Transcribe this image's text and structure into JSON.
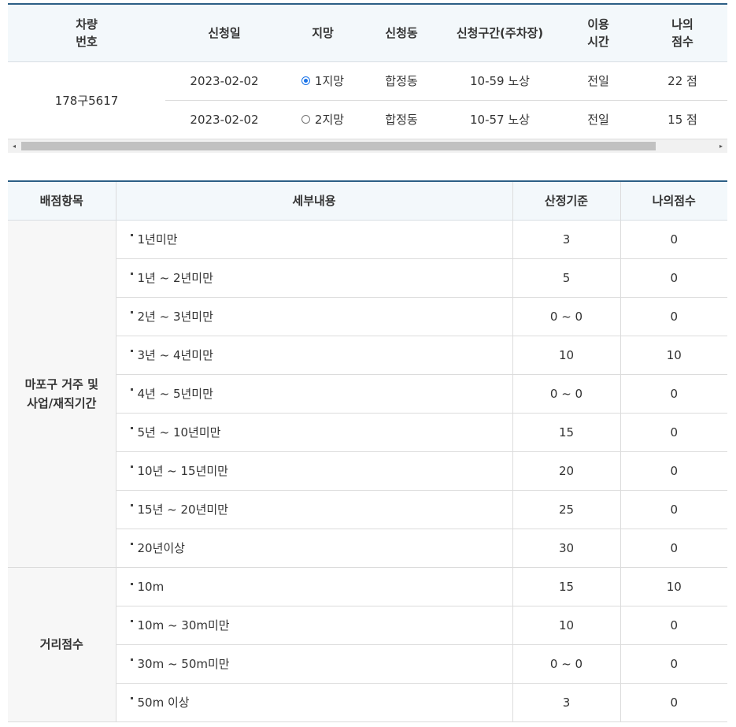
{
  "application_table": {
    "headers": [
      "차량\n번호",
      "신청일",
      "지망",
      "신청동",
      "신청구간(주차장)",
      "이용\n시간",
      "나의\n점수"
    ],
    "vehicle_number": "178구5617",
    "rows": [
      {
        "date": "2023-02-02",
        "choice": "1지망",
        "selected": true,
        "dong": "합정동",
        "section": "10-59 노상",
        "time": "전일",
        "score": "22 점"
      },
      {
        "date": "2023-02-02",
        "choice": "2지망",
        "selected": false,
        "dong": "합정동",
        "section": "10-57 노상",
        "time": "전일",
        "score": "15 점"
      }
    ]
  },
  "scrollbar": {
    "left_arrow": "◂",
    "right_arrow": "▸"
  },
  "score_table": {
    "headers": [
      "배점항목",
      "세부내용",
      "산정기준",
      "나의점수"
    ],
    "categories": [
      {
        "name": "마포구 거주 및\n사업/재직기간",
        "rows": [
          {
            "detail": "1년미만",
            "standard": "3",
            "my": "0"
          },
          {
            "detail": "1년 ~ 2년미만",
            "standard": "5",
            "my": "0"
          },
          {
            "detail": "2년 ~ 3년미만",
            "standard": "0 ~ 0",
            "my": "0"
          },
          {
            "detail": "3년 ~ 4년미만",
            "standard": "10",
            "my": "10"
          },
          {
            "detail": "4년 ~ 5년미만",
            "standard": "0 ~ 0",
            "my": "0"
          },
          {
            "detail": "5년 ~ 10년미만",
            "standard": "15",
            "my": "0"
          },
          {
            "detail": "10년 ~ 15년미만",
            "standard": "20",
            "my": "0"
          },
          {
            "detail": "15년 ~ 20년미만",
            "standard": "25",
            "my": "0"
          },
          {
            "detail": "20년이상",
            "standard": "30",
            "my": "0"
          }
        ]
      },
      {
        "name": "거리점수",
        "rows": [
          {
            "detail": "10m",
            "standard": "15",
            "my": "10"
          },
          {
            "detail": "10m ~ 30m미만",
            "standard": "10",
            "my": "0"
          },
          {
            "detail": "30m ~ 50m미만",
            "standard": "0 ~ 0",
            "my": "0"
          },
          {
            "detail": "50m 이상",
            "standard": "3",
            "my": "0"
          }
        ]
      }
    ]
  },
  "colors": {
    "header_border": "#2c5f86",
    "header_bg": "#f3f8fb",
    "category_bg": "#f7f7f7",
    "radio_accent": "#1a73e8"
  }
}
